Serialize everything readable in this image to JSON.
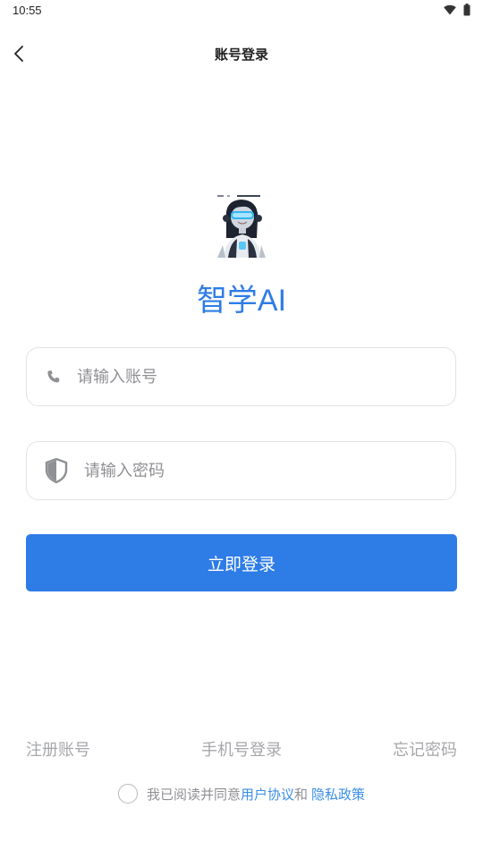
{
  "status_bar": {
    "time": "10:55",
    "icons": [
      "wifi-icon",
      "battery-icon"
    ]
  },
  "nav": {
    "back_icon": "chevron-left-icon",
    "title": "账号登录"
  },
  "app": {
    "name": "智学AI",
    "logo_icon": "robot-avatar-icon"
  },
  "form": {
    "account": {
      "icon": "phone-icon",
      "value": "",
      "placeholder": "请输入账号"
    },
    "password": {
      "icon": "shield-icon",
      "value": "",
      "placeholder": "请输入密码"
    },
    "login_label": "立即登录"
  },
  "links": {
    "register": "注册账号",
    "phone_login": "手机号登录",
    "forgot_password": "忘记密码"
  },
  "agreement": {
    "checked": false,
    "prefix": "我已阅读并同意",
    "user_agreement": "用户协议",
    "conjunction": "和",
    "privacy_policy": "隐私政策"
  },
  "colors": {
    "accent": "#2e7ce6",
    "link": "#3a8ee6",
    "muted_text": "#a6a7ab",
    "input_border": "#e2e3e7"
  }
}
